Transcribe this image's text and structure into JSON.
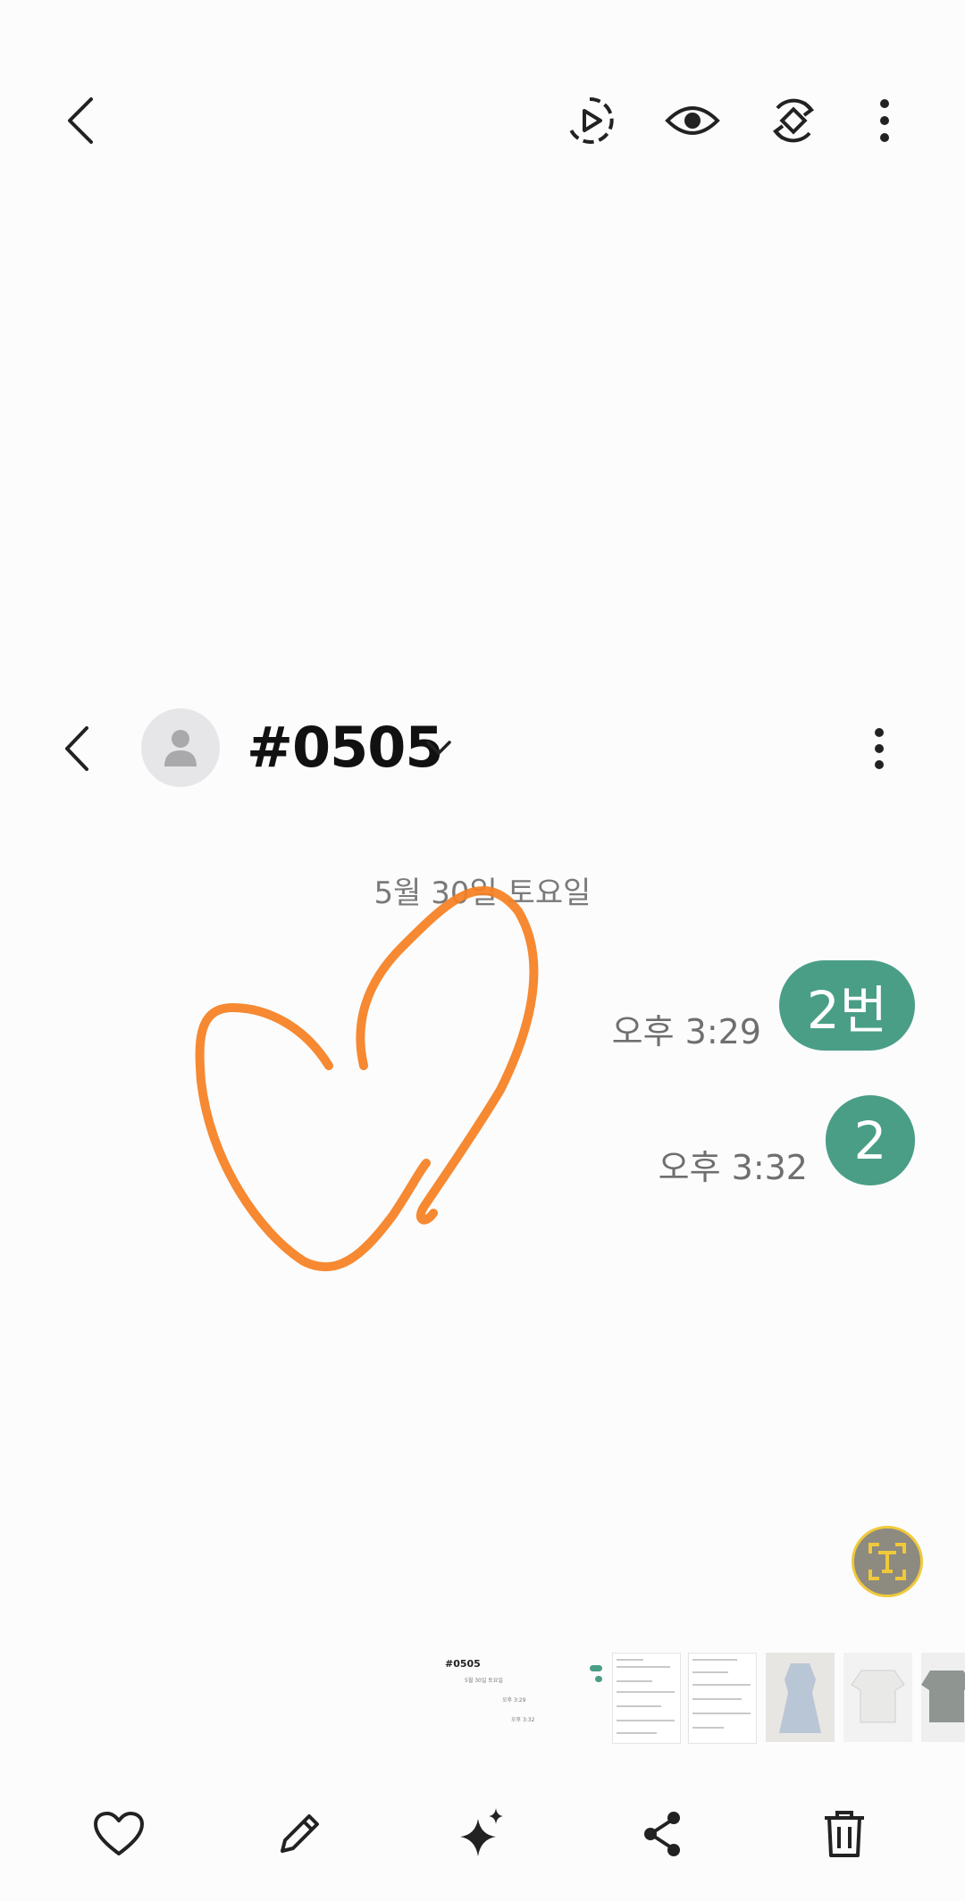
{
  "viewer": {
    "toolbar": {
      "back_icon": "back-arrow-icon",
      "actions": [
        "motion-play-icon",
        "eye-icon",
        "rotate-icon",
        "more-vertical-icon"
      ]
    },
    "bottom_actions": [
      "heart-icon",
      "pencil-icon",
      "sparkle-icon",
      "share-icon",
      "trash-icon"
    ],
    "ocr_button_icon": "text-recognition-icon"
  },
  "screenshot": {
    "chat": {
      "title": "#0505",
      "date": "5월 30일 토요일",
      "messages": [
        {
          "time": "오후 3:29",
          "text": "2번"
        },
        {
          "time": "오후 3:32",
          "text": "2"
        }
      ]
    },
    "drawing": {
      "shape": "heart",
      "color": "#f57f1f"
    }
  },
  "thumbnails": {
    "first_caption": "#0505",
    "first_date": "5월 30일 토요일",
    "first_msg1": "오후 3:29",
    "first_msg2": "오후 3:32"
  },
  "colors": {
    "bubble": "#4a9e86",
    "background": "#fcfcfd",
    "accent_ocr": "#f0c93a"
  }
}
